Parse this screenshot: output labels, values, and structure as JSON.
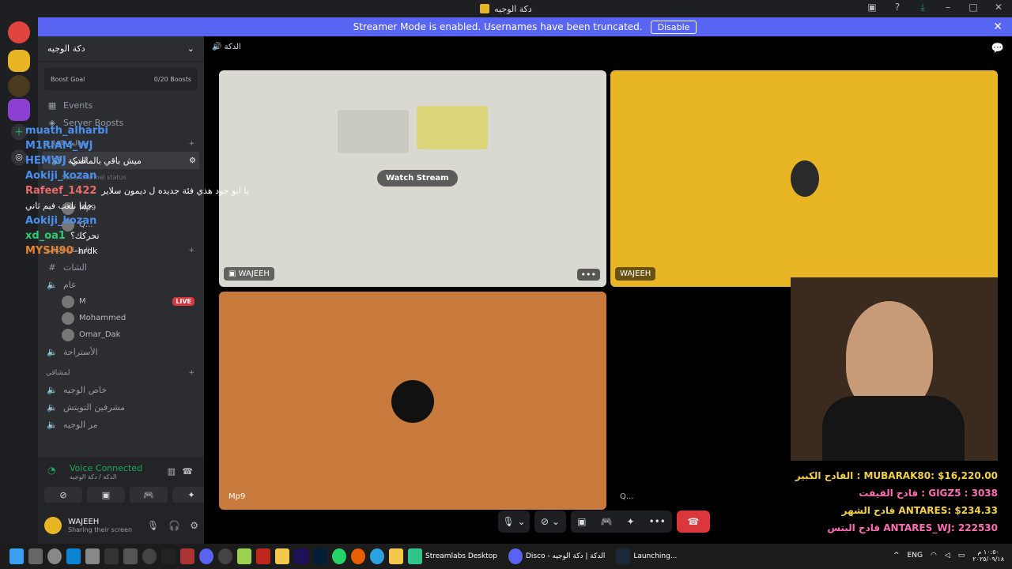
{
  "window": {
    "title": "دكة الوجيه"
  },
  "banner": {
    "text": "Streamer Mode is enabled. Usernames have been truncated.",
    "button": "Disable"
  },
  "sidebar": {
    "server_name": "دكة الوجيه",
    "boost_label": "Boost Goal",
    "boost_progress": "0/20 Boosts",
    "events": "Events",
    "server_boosts": "Server Boosts",
    "cat1": "مجالس الحارة",
    "voice_channel": "الدكة",
    "status_hint": "Set a channel status",
    "users1": [
      "Mp9",
      "Q..."
    ],
    "cat2": "الرومات العامة",
    "chat_channel": "الشات",
    "general_voice": "عام",
    "users2": [
      {
        "name": "M",
        "live": "LIVE"
      },
      {
        "name": "Mohammed",
        "live": ""
      },
      {
        "name": "Omar_Dak",
        "live": ""
      }
    ],
    "rest_channel": "الأستراحة",
    "cat3": "لمشاقي",
    "private1": "خاص الوجيه",
    "private2": "مشرفين التويتش",
    "private3": "مر الوجيه"
  },
  "voice_panel": {
    "status": "Voice Connected",
    "sub": "الدكة / دكة الوجيه",
    "username": "WAJEEH",
    "user_status": "Sharing their screen"
  },
  "main": {
    "channel_title": "الدكة",
    "watch_stream": "Watch Stream",
    "tiles": [
      "WAJEEH",
      "WAJEEH",
      "Mp9",
      "Q..."
    ],
    "more_label": "•••"
  },
  "overlay_chat": [
    {
      "user": "muath_alharbi",
      "color": "#4a8ff0",
      "msg": ""
    },
    {
      "user": "M1RIAM_WJ",
      "color": "#4a8ff0",
      "msg": ""
    },
    {
      "user": "HEMWJ",
      "color": "#4a8ff0",
      "msg": "ميش باقي بالماضي"
    },
    {
      "user": "Aokiji_kozan",
      "color": "#4a8ff0",
      "msg": ""
    },
    {
      "user": "Rafeef_1422",
      "color": "#e86a6a",
      "msg": "يا ابو جود هذي فئة جديده ل ديمون سلاير"
    },
    {
      "user": "",
      "color": "#ffffff",
      "msg": "خلنا نلعب فيم ثاني"
    },
    {
      "user": "Aokiji_kozan",
      "color": "#4a8ff0",
      "msg": ""
    },
    {
      "user": "xd_oa1",
      "color": "#2ecc71",
      "msg": "تحركك؟"
    },
    {
      "user": "MYSH90",
      "color": "#e8822a",
      "msg": "hrdk"
    }
  ],
  "donors": [
    {
      "text": "القادح الكبير : MUBARAK80: $16,220.00",
      "color": "#f2d14a"
    },
    {
      "text": "قادح القيفت : GIGZ5 : 3038",
      "color": "#ff6eb4"
    },
    {
      "text": "قادح الشهر ANTARES: $234.33",
      "color": "#f2d14a"
    },
    {
      "text": "قادح البتس ANTARES_WJ: 222530",
      "color": "#ff6eb4"
    }
  ],
  "taskbar": {
    "streamlabs": "Streamlabs Desktop",
    "discord": "Disco - الدكة | دكة الوجيه",
    "steam": "Launching...",
    "lang": "ENG",
    "time": "١٠:٥٠ م",
    "date": "٢٠٢٥/٠٩/١٨"
  },
  "colors": {
    "accent": "#5865f2",
    "voice_green": "#23a55a",
    "tile_yellow": "#e8b624",
    "tile_orange": "#c87a3c",
    "end_call": "#da373c"
  }
}
